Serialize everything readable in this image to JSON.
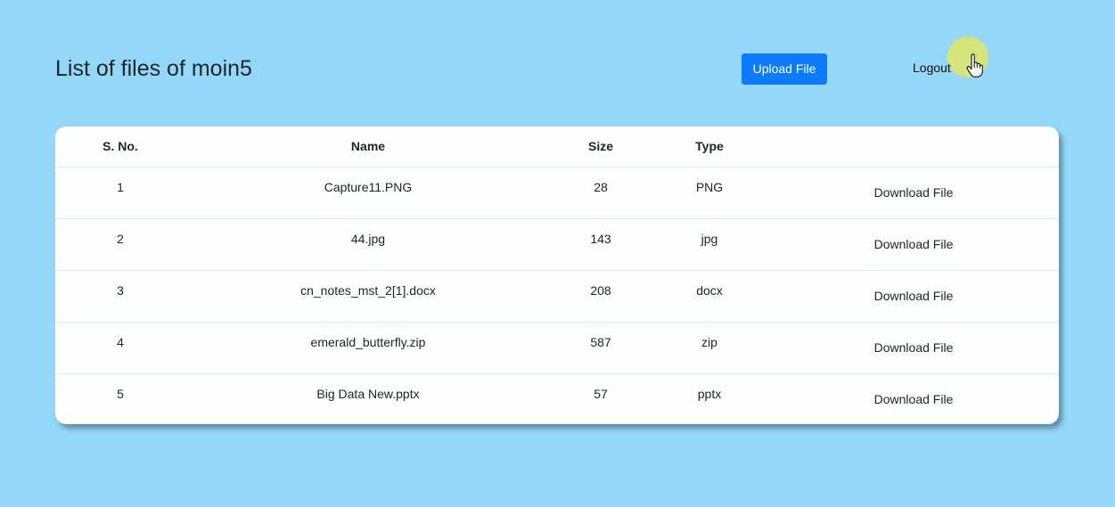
{
  "header": {
    "title": "List of files of moin5",
    "upload_label": "Upload File",
    "logout_label": "Logout"
  },
  "table": {
    "columns": [
      "S. No.",
      "Name",
      "Size",
      "Type",
      ""
    ],
    "rows": [
      {
        "sno": "1",
        "name": "Capture11.PNG",
        "size": "28",
        "type": "PNG",
        "action": "Download File"
      },
      {
        "sno": "2",
        "name": "44.jpg",
        "size": "143",
        "type": "jpg",
        "action": "Download File"
      },
      {
        "sno": "3",
        "name": "cn_notes_mst_2[1].docx",
        "size": "208",
        "type": "docx",
        "action": "Download File"
      },
      {
        "sno": "4",
        "name": "emerald_butterfly.zip",
        "size": "587",
        "type": "zip",
        "action": "Download File"
      },
      {
        "sno": "5",
        "name": "Big Data New.pptx",
        "size": "57",
        "type": "pptx",
        "action": "Download File"
      }
    ]
  },
  "colors": {
    "background": "#93d8f8",
    "primary_button": "#0d7bfd",
    "cursor_highlight": "#e1e864"
  },
  "icons": {
    "cursor": "hand-pointer-icon"
  }
}
